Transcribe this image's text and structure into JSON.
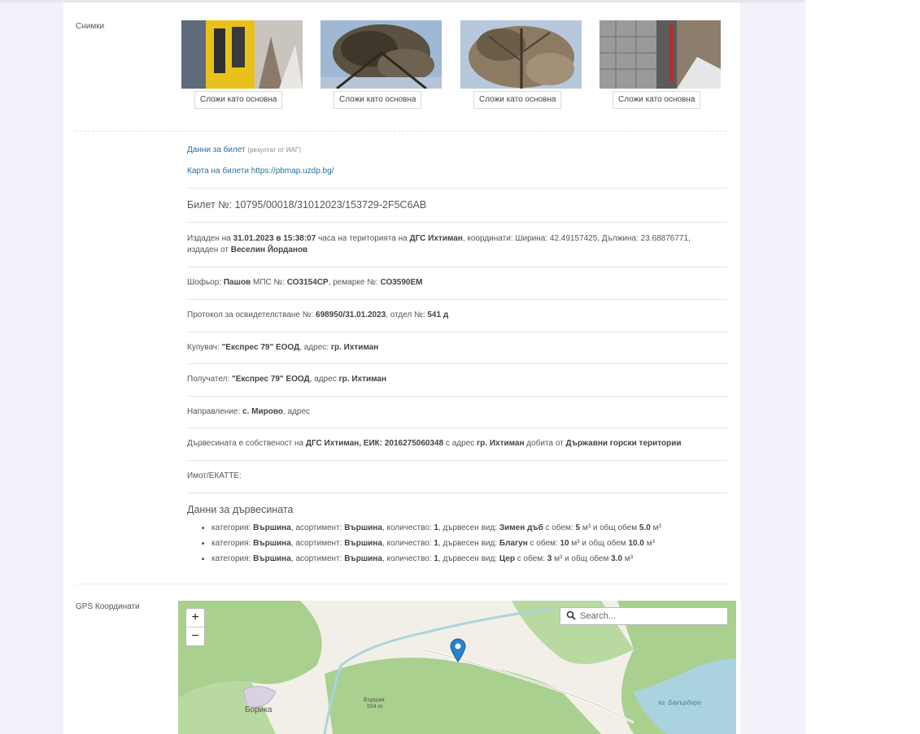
{
  "photos": {
    "label": "Снимки",
    "set_main_label": "Сложи като основна",
    "items": [
      {
        "name": "photo-1"
      },
      {
        "name": "photo-2"
      },
      {
        "name": "photo-3"
      },
      {
        "name": "photo-4"
      }
    ]
  },
  "ticket": {
    "data_link": "Данни за билет",
    "data_link_note": "(резултат от ИАГ)",
    "map_link": "Карта на билети https://pbmap.uzdp.bg/",
    "number_label": "Билет №:",
    "number": "10795/00018/31012023/153729-2F5C6AB",
    "issued": {
      "p1": "Издаден на",
      "datetime": "31.01.2023 в 15:38:07",
      "p2": "часа на територията на",
      "territory": "ДГС Ихтиман",
      "p3": ", координати: Ширина: 42.49157425, Дължина: 23.68876771,",
      "p4": "издаден от",
      "issuer": "Веселин Йорданов"
    },
    "driver": {
      "p1": "Шофьор:",
      "name": "Пашов",
      "p2": "МПС №:",
      "plate": "СО3154СР",
      "p3": ", ремарке №:",
      "trailer": "СО3590ЕМ"
    },
    "protocol": {
      "p1": "Протокол за освидетелстване №:",
      "number": "698950/31.01.2023",
      "p2": ", отдел №:",
      "section": "541 д"
    },
    "buyer": {
      "p1": "Купувач:",
      "name": "\"Експрес 79\" ЕООД",
      "p2": ", адрес:",
      "address": "гр. Ихтиман"
    },
    "recipient": {
      "p1": "Получател:",
      "name": "\"Експрес 79\" ЕООД",
      "p2": ", адрес",
      "address": "гр. Ихтиман"
    },
    "direction": {
      "p1": "Направление:",
      "place": "с. Мирово",
      "p2": ", адрес"
    },
    "ownership": {
      "p1": "Дървесината е собственост на",
      "owner": "ДГС Ихтиман, ЕИК: 2016275060348",
      "p2": "с адрес",
      "address": "гр. Ихтиман",
      "p3": "добита от",
      "source": "Държавни горски територии"
    },
    "property": "Имот/ЕКАТТЕ:"
  },
  "wood": {
    "title": "Данни за дървесината",
    "lbl_category": "категория:",
    "lbl_assortment": ", асортимент:",
    "lbl_quantity": ", количество:",
    "lbl_species": ", дървесен вид:",
    "lbl_volume": "с обем:",
    "lbl_total": "и общ обем",
    "unit": "м³",
    "items": [
      {
        "category": "Вършина",
        "assortment": "Вършина",
        "quantity": "1",
        "species": "Зимен дъб",
        "volume": "5",
        "total": "5.0"
      },
      {
        "category": "Вършина",
        "assortment": "Вършина",
        "quantity": "1",
        "species": "Благун",
        "volume": "10",
        "total": "10.0"
      },
      {
        "category": "Вършина",
        "assortment": "Вършина",
        "quantity": "1",
        "species": "Цер",
        "volume": "3",
        "total": "3.0"
      }
    ]
  },
  "gps": {
    "label": "GPS Координати",
    "zoom_in": "+",
    "zoom_out": "−",
    "search_placeholder": "Search...",
    "places": {
      "village": "Борика",
      "peak": "Вършик",
      "peak_elev": "934 m",
      "lake": "яз. Бакърдере"
    },
    "colors": {
      "forest": "#a9d08e",
      "field": "#f2efe9",
      "water": "#aad3df",
      "marker": "#2a81cb"
    }
  }
}
